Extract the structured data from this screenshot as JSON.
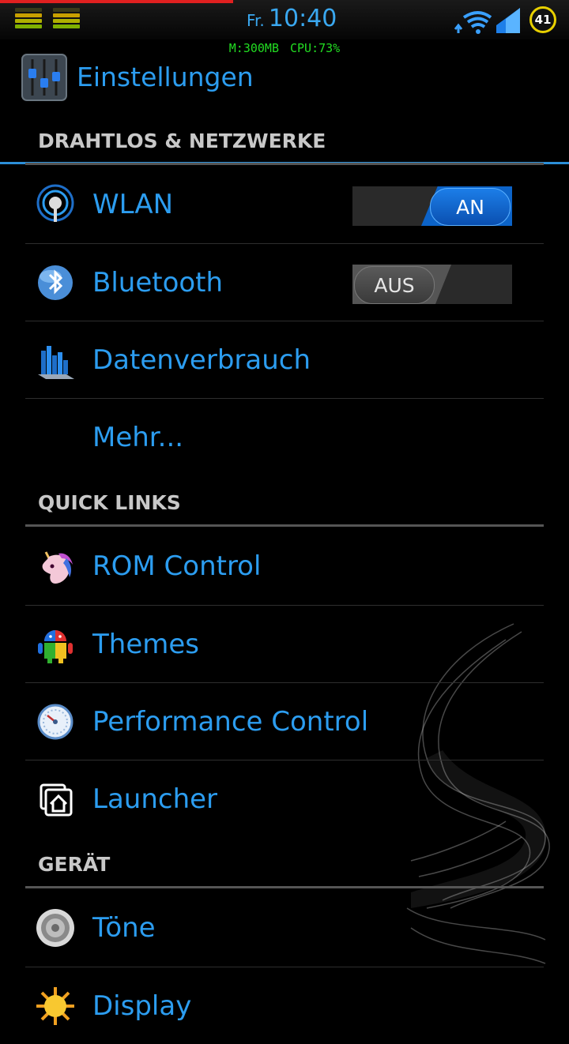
{
  "status_bar": {
    "day": "Fr.",
    "time": "10:40",
    "memory": "M:300MB",
    "cpu": "CPU:73%",
    "battery_level": "41",
    "icons": [
      "equalizer-icon",
      "equalizer-icon",
      "upload-arrow-icon",
      "wifi-icon",
      "signal-icon",
      "battery-icon"
    ]
  },
  "action_bar": {
    "title": "Einstellungen",
    "icon": "settings-sliders-icon"
  },
  "sections": {
    "wireless": {
      "header": "DRAHTLOS & NETZWERKE",
      "items": {
        "wlan": {
          "label": "WLAN",
          "icon": "wlan-icon",
          "toggle": "AN",
          "on": true
        },
        "bluetooth": {
          "label": "Bluetooth",
          "icon": "bluetooth-icon",
          "toggle": "AUS",
          "on": false
        },
        "data": {
          "label": "Datenverbrauch",
          "icon": "data-usage-icon"
        },
        "more": {
          "label": "Mehr..."
        }
      }
    },
    "quick_links": {
      "header": "QUICK LINKS",
      "items": {
        "rom": {
          "label": "ROM Control",
          "icon": "unicorn-icon"
        },
        "themes": {
          "label": "Themes",
          "icon": "android-themes-icon"
        },
        "performance": {
          "label": "Performance Control",
          "icon": "gauge-icon"
        },
        "launcher": {
          "label": "Launcher",
          "icon": "home-icon"
        }
      }
    },
    "device": {
      "header": "GERÄT",
      "items": {
        "sound": {
          "label": "Töne",
          "icon": "speaker-icon"
        },
        "display": {
          "label": "Display",
          "icon": "sun-icon"
        }
      }
    }
  },
  "colors": {
    "accent": "#2c9df0",
    "toggle_on": "#0c63c8",
    "sysinfo": "#22dd22"
  }
}
